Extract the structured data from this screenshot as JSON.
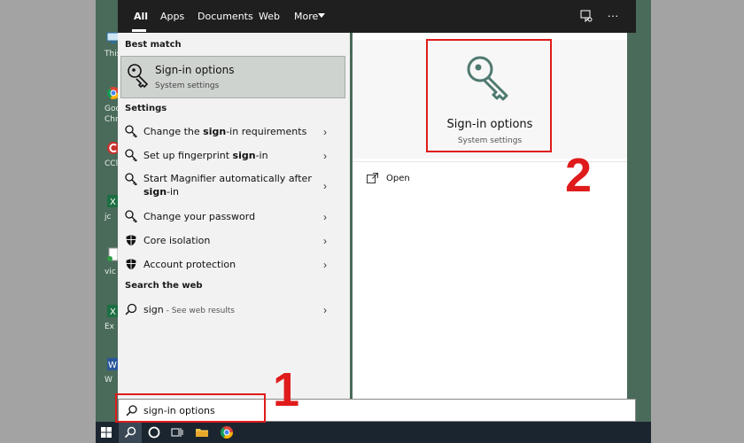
{
  "search_tabs": [
    {
      "label": "All",
      "active": true
    },
    {
      "label": "Apps"
    },
    {
      "label": "Documents"
    },
    {
      "label": "Web"
    },
    {
      "label": "More"
    }
  ],
  "top_icons": [
    "feedback-icon",
    "more-icon"
  ],
  "best_match": {
    "heading": "Best match",
    "title": "Sign-in options",
    "subtitle": "System settings",
    "icon": "key-icon"
  },
  "settings": {
    "heading": "Settings",
    "items": [
      {
        "pre": "Change the ",
        "bold": "sign",
        "post": "-in requirements",
        "icon": "key-icon"
      },
      {
        "pre": "Set up fingerprint ",
        "bold": "sign",
        "post": "-in",
        "icon": "key-icon"
      },
      {
        "pre": "Start Magnifier automatically after",
        "line2_bold": "sign",
        "line2_post": "-in",
        "icon": "key-icon"
      },
      {
        "pre": "Change your password",
        "icon": "key-icon"
      },
      {
        "pre": "Core isolation",
        "icon": "shield-icon"
      },
      {
        "pre": "Account protection",
        "icon": "shield-icon"
      }
    ]
  },
  "web": {
    "heading": "Search the web",
    "query": "sign",
    "suffix": " - See web results",
    "icon": "search-icon"
  },
  "preview": {
    "title": "Sign-in options",
    "subtitle": "System settings",
    "open_label": "Open",
    "icon": "key-icon"
  },
  "search_box": {
    "value": "sign-in options"
  },
  "annotations": {
    "callout_1": "1",
    "callout_2": "2",
    "color": "#e01b1b"
  },
  "desktop_labels": [
    "This",
    "Goo",
    "Chro",
    "CCle",
    "jc",
    "vic",
    "Ex",
    "W"
  ],
  "taskbar_icons": [
    "windows-start-icon",
    "search-icon",
    "cortana-icon",
    "task-view-icon",
    "file-explorer-icon",
    "chrome-icon"
  ]
}
